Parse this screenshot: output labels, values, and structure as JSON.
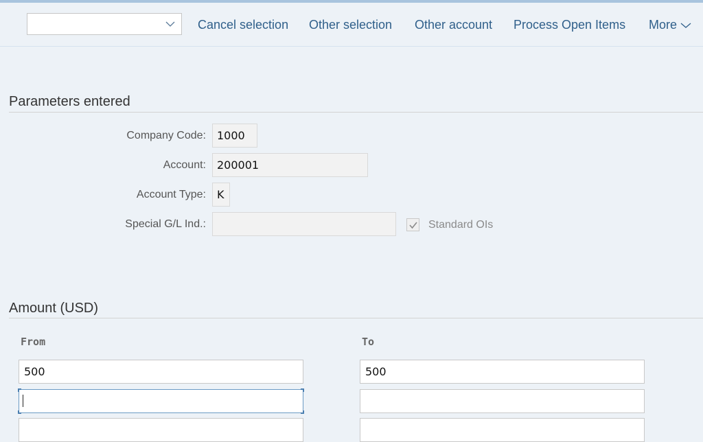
{
  "toolbar": {
    "dropdown_value": "",
    "actions": [
      {
        "label": "Cancel selection"
      },
      {
        "label": "Other selection"
      },
      {
        "label": "Other account"
      },
      {
        "label": "Process Open Items"
      },
      {
        "label": "More"
      }
    ]
  },
  "parameters": {
    "title": "Parameters entered",
    "fields": [
      {
        "label": "Company Code:",
        "value": "1000"
      },
      {
        "label": "Account:",
        "value": "200001"
      },
      {
        "label": "Account Type:",
        "value": "K"
      },
      {
        "label": "Special G/L Ind.:",
        "value": ""
      }
    ],
    "standard_ois": {
      "label": "Standard OIs",
      "checked": true
    }
  },
  "amount": {
    "title": "Amount (USD)",
    "from_label": "From",
    "to_label": "To",
    "rows": [
      {
        "from": "500",
        "to": "500"
      },
      {
        "from": "",
        "to": ""
      },
      {
        "from": "",
        "to": ""
      }
    ]
  },
  "colors": {
    "link": "#2f5f8a",
    "background": "#edf2f7",
    "accent_bar": "#a8c4de",
    "focus_border": "#4a7eb0"
  }
}
